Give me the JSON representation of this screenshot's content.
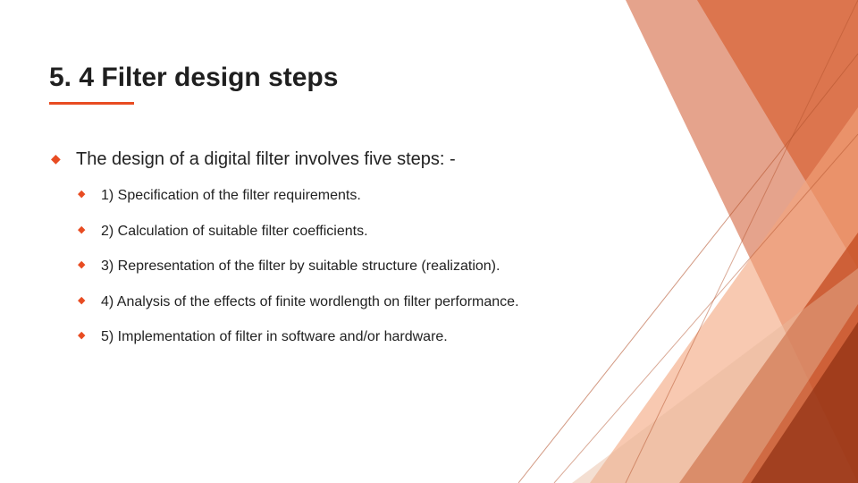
{
  "title": "5. 4 Filter design steps",
  "intro": "The design of a digital filter involves five steps: -",
  "steps": {
    "s1": "1) Specification of the filter requirements.",
    "s2": "2) Calculation of suitable filter coefficients.",
    "s3": "3) Representation of the filter by suitable structure (realization).",
    "s4": "4) Analysis of the effects of finite wordlength on filter performance.",
    "s5": "5) Implementation of filter in software and/or hardware."
  }
}
